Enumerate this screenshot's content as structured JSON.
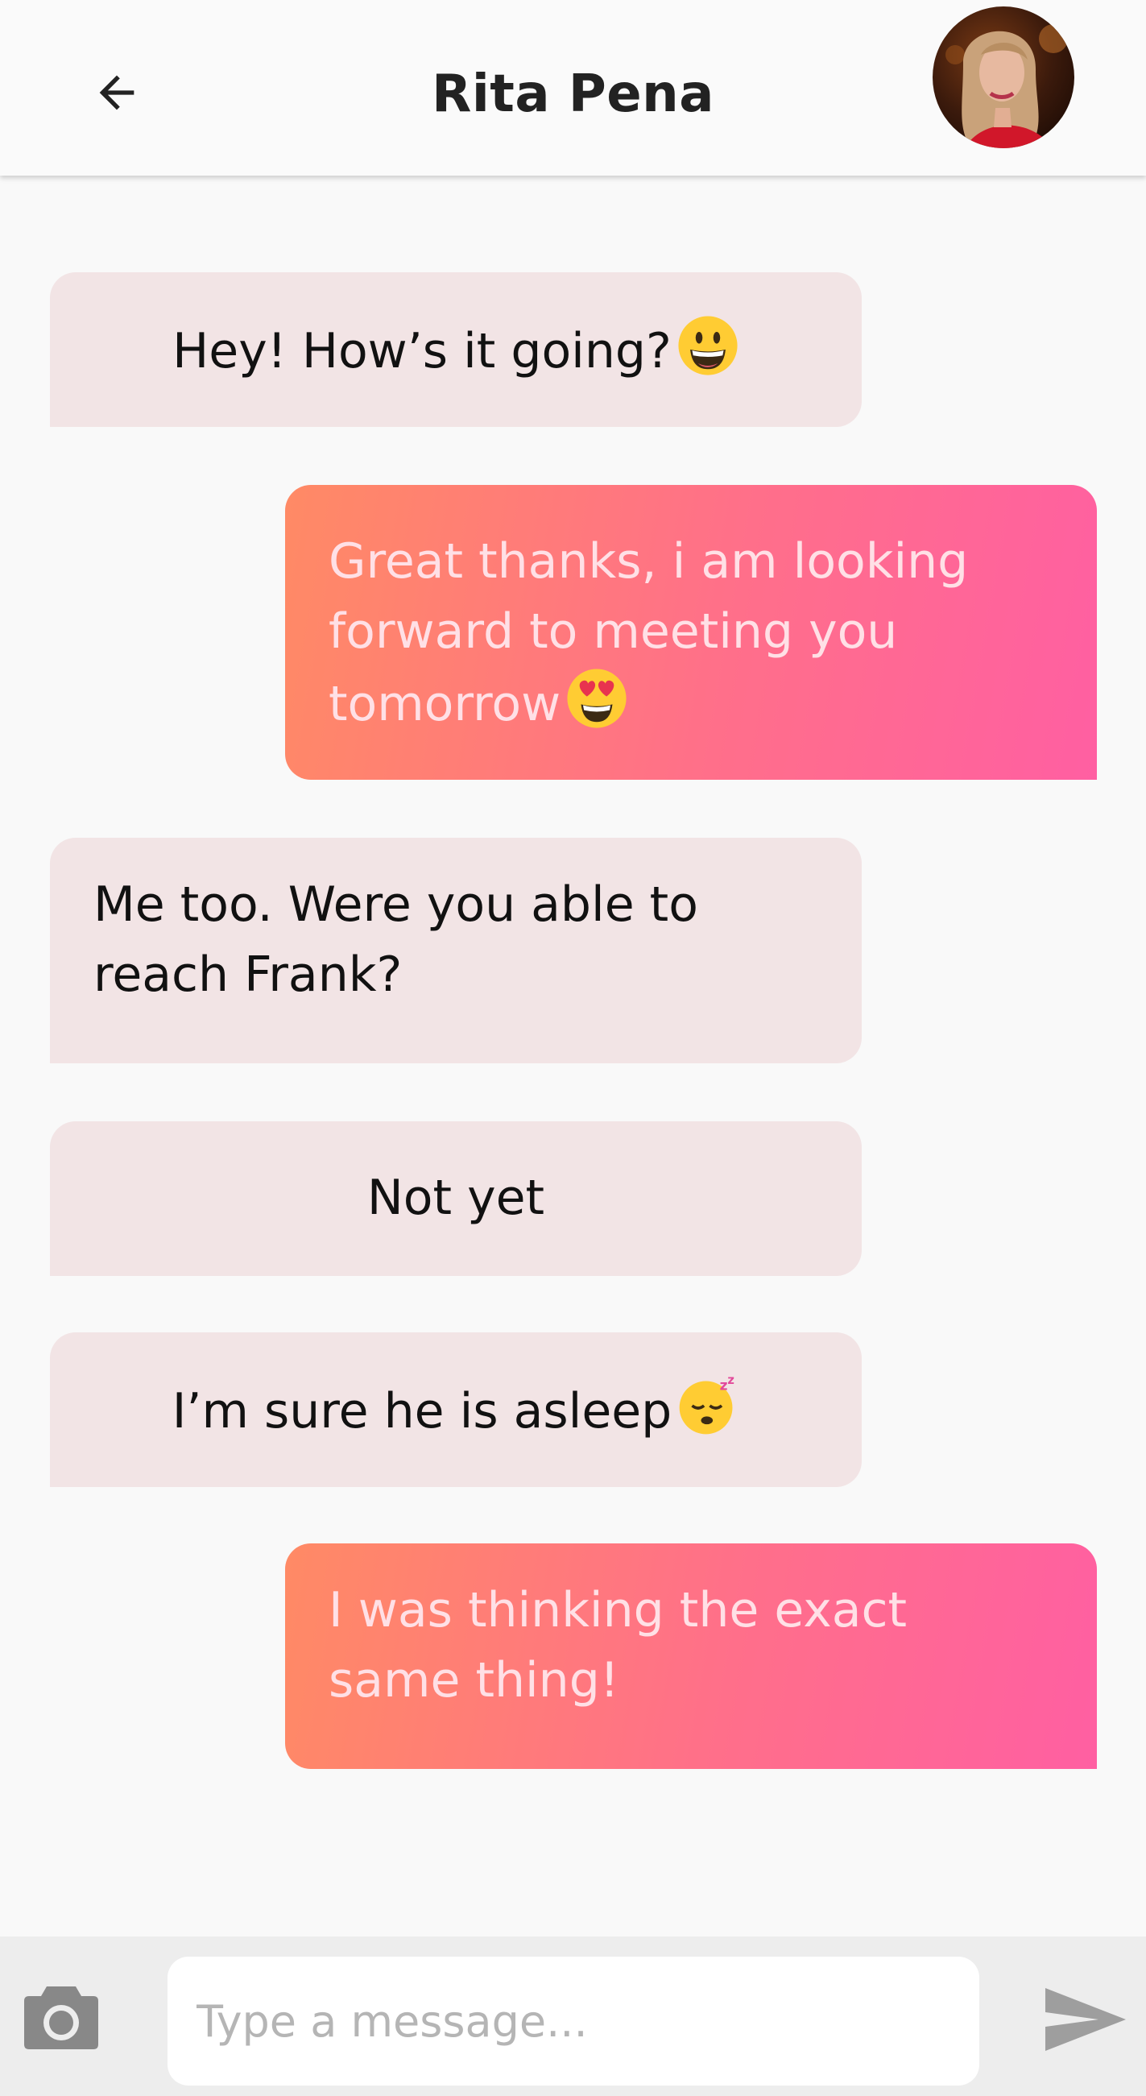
{
  "header": {
    "title": "Rita Pena",
    "back_icon": "arrow-left-icon",
    "avatar": "contact-avatar-photo"
  },
  "messages": [
    {
      "direction": "incoming",
      "text": "Hey! How’s it going?",
      "emoji": "grinning-face"
    },
    {
      "direction": "outgoing",
      "text": "Great thanks, i am looking forward to meeting you tomorrow",
      "emoji": "heart-eyes-face"
    },
    {
      "direction": "incoming",
      "text": "Me too. Were you able to reach Frank?"
    },
    {
      "direction": "incoming",
      "text": "Not yet"
    },
    {
      "direction": "incoming",
      "text": "I’m sure he is asleep",
      "emoji": "sleeping-face"
    },
    {
      "direction": "outgoing",
      "text": "I was thinking the exact same thing!"
    }
  ],
  "composer": {
    "placeholder": "Type a message...",
    "value": "",
    "camera_icon": "camera-icon",
    "send_icon": "send-icon"
  },
  "colors": {
    "incoming_bubble": "#f2e4e5",
    "outgoing_gradient_start": "#ff8a65",
    "outgoing_gradient_end": "#ff5fa2",
    "outgoing_text": "#ffe0e6",
    "header_bg": "#fafafa",
    "composer_bg": "#ededed"
  }
}
